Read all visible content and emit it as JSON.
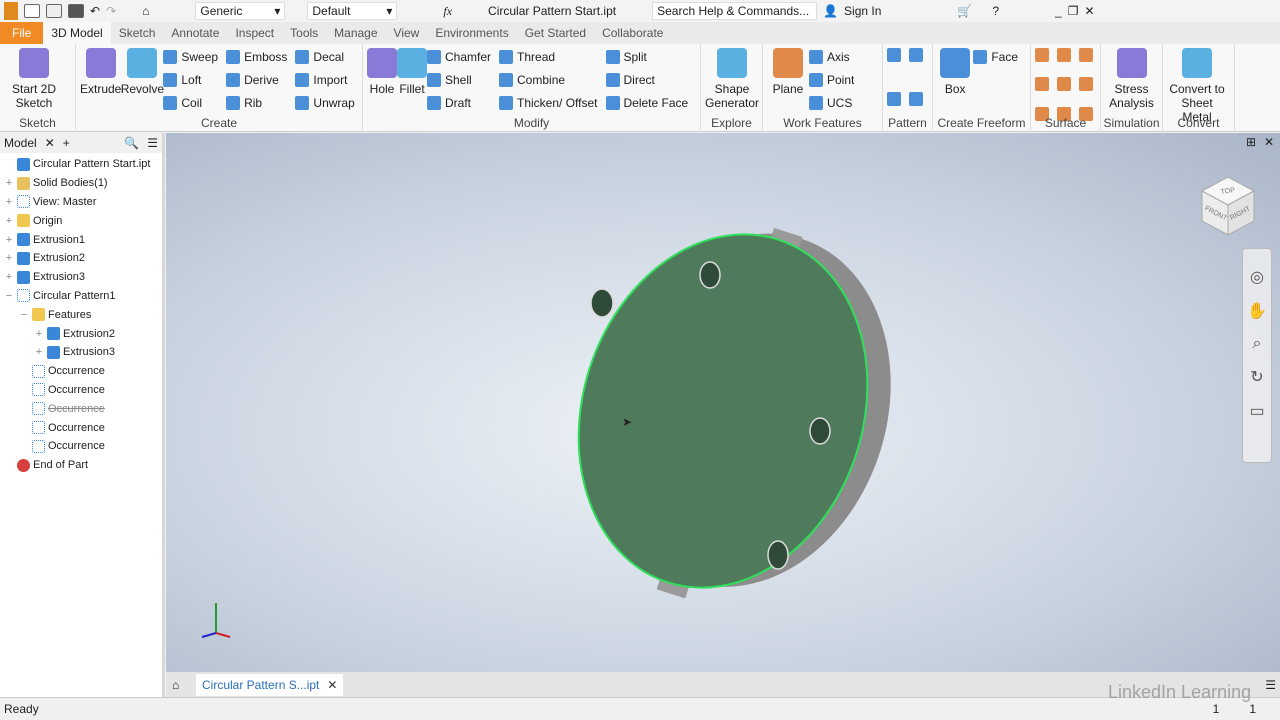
{
  "titlebar": {
    "title": "Circular Pattern Start.ipt",
    "material": "Generic",
    "appearance": "Default",
    "search_placeholder": "Search Help & Commands...",
    "sign_in": "Sign In"
  },
  "tabs": [
    "File",
    "3D Model",
    "Sketch",
    "Annotate",
    "Inspect",
    "Tools",
    "Manage",
    "View",
    "Environments",
    "Get Started",
    "Collaborate"
  ],
  "active_tab": "3D Model",
  "ribbon": {
    "sketch": {
      "label": "Sketch",
      "big": [
        "Start 2D Sketch"
      ]
    },
    "create": {
      "label": "Create",
      "big": [
        "Extrude",
        "Revolve"
      ],
      "cols": [
        [
          "Sweep",
          "Loft",
          "Coil"
        ],
        [
          "Emboss",
          "Derive",
          "Rib"
        ],
        [
          "Decal",
          "Import",
          "Unwrap"
        ]
      ]
    },
    "modify": {
      "label": "Modify",
      "big": [
        "Hole",
        "Fillet"
      ],
      "cols": [
        [
          "Chamfer",
          "Shell",
          "Draft"
        ],
        [
          "Thread",
          "Combine",
          "Thicken/ Offset"
        ],
        [
          "Split",
          "Direct",
          "Delete Face"
        ]
      ]
    },
    "explore": {
      "label": "Explore",
      "big": [
        "Shape Generator"
      ]
    },
    "work_features": {
      "label": "Work Features",
      "big": [
        "Plane"
      ],
      "cols": [
        [
          "Axis",
          "Point",
          "UCS"
        ]
      ]
    },
    "pattern": {
      "label": "Pattern"
    },
    "freeform": {
      "label": "Create Freeform",
      "big": [
        "Box"
      ],
      "cols": [
        [
          "Face"
        ]
      ]
    },
    "surface": {
      "label": "Surface"
    },
    "simulation": {
      "label": "Simulation",
      "big": [
        "Stress Analysis"
      ]
    },
    "convert": {
      "label": "Convert",
      "big": [
        "Convert to Sheet Metal"
      ]
    }
  },
  "browser": {
    "tab": "Model",
    "nodes": [
      {
        "label": "Circular Pattern Start.ipt",
        "level": 0,
        "icon": "part-icon",
        "exp": ""
      },
      {
        "label": "Solid Bodies(1)",
        "level": 0,
        "icon": "solid-bodies-icon",
        "exp": "+"
      },
      {
        "label": "View: Master",
        "level": 0,
        "icon": "view-icon",
        "exp": "+"
      },
      {
        "label": "Origin",
        "level": 0,
        "icon": "folder-icon",
        "exp": "+"
      },
      {
        "label": "Extrusion1",
        "level": 0,
        "icon": "extrusion-icon",
        "exp": "+"
      },
      {
        "label": "Extrusion2",
        "level": 0,
        "icon": "extrusion-icon",
        "exp": "+"
      },
      {
        "label": "Extrusion3",
        "level": 0,
        "icon": "extrusion-icon",
        "exp": "+"
      },
      {
        "label": "Circular Pattern1",
        "level": 0,
        "icon": "circular-pattern-icon",
        "exp": "−"
      },
      {
        "label": "Features",
        "level": 1,
        "icon": "folder-icon",
        "exp": "−"
      },
      {
        "label": "Extrusion2",
        "level": 2,
        "icon": "extrusion-icon",
        "exp": "+"
      },
      {
        "label": "Extrusion3",
        "level": 2,
        "icon": "extrusion-icon",
        "exp": "+"
      },
      {
        "label": "Occurrence",
        "level": 1,
        "icon": "occurrence-icon",
        "exp": ""
      },
      {
        "label": "Occurrence",
        "level": 1,
        "icon": "occurrence-icon",
        "exp": ""
      },
      {
        "label": "Occurrence",
        "level": 1,
        "icon": "occurrence-icon",
        "exp": "",
        "suppressed": true
      },
      {
        "label": "Occurrence",
        "level": 1,
        "icon": "occurrence-icon",
        "exp": ""
      },
      {
        "label": "Occurrence",
        "level": 1,
        "icon": "occurrence-icon",
        "exp": ""
      },
      {
        "label": "End of Part",
        "level": 0,
        "icon": "end-of-part-icon",
        "exp": ""
      }
    ]
  },
  "viewcube": {
    "front": "FRONT",
    "right": "RIGHT",
    "top": "TOP"
  },
  "doc_tab": "Circular Pattern S...ipt",
  "status": {
    "text": "Ready",
    "count1": "1",
    "count2": "1"
  },
  "watermark": "LinkedIn Learning",
  "colors": {
    "file_tab": "#f08a24",
    "face": "#4f7a5c",
    "edge": "#2fe05a",
    "rim": "#8c8c8c"
  }
}
